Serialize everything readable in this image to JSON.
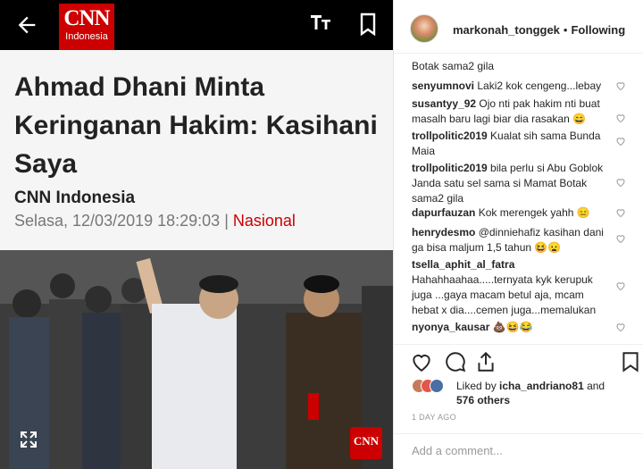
{
  "article": {
    "logo_main": "CNN",
    "logo_sub": "Indonesia",
    "text_size_icon_label": "ŦT",
    "headline": "Ahmad Dhani Minta Keringanan Hakim: Kasihani Saya",
    "source": "CNN Indonesia",
    "date": "Selasa, 12/03/2019 18:29:03",
    "separator": " | ",
    "category": "Nasional",
    "badge": "CNN",
    "accent_color": "#cc0000"
  },
  "post": {
    "username": "markonah_tonggek",
    "dot": "•",
    "follow_status": "Following",
    "comments": [
      {
        "user": "",
        "text": "Botak sama2 gila"
      },
      {
        "user": "senyumnovi",
        "text": "Laki2 kok cengeng...lebay"
      },
      {
        "user": "susantyy_92",
        "text": "Ojo nti pak hakim nti buat masalh baru lagi biar dia rasakan 😄"
      },
      {
        "user": "trollpolitic2019",
        "text": "Kualat sih sama Bunda Maia"
      },
      {
        "user": "trollpolitic2019",
        "text": "bila perlu si Abu Goblok Janda satu sel sama si Mamat Botak sama2 gila"
      },
      {
        "user": "dapurfauzan",
        "text": "Kok merengek yahh 😑"
      },
      {
        "user": "henrydesmo",
        "text": "@dinniehafiz kasihan dani ga bisa maljum 1,5 tahun 😆😦"
      },
      {
        "user": "tsella_aphit_al_fatra",
        "text": "Hahahhaahaa.....ternyata kyk kerupuk juga ...gaya macam betul aja, mcam hebat x dia....cemen juga...memalukan"
      },
      {
        "user": "nyonya_kausar",
        "text": "💩😆😂"
      }
    ],
    "liked_by_prefix": "Liked by ",
    "liked_by_user": "icha_andriano81",
    "liked_by_and": " and",
    "liked_by_count": "576 others",
    "time": "1 DAY AGO",
    "add_comment_placeholder": "Add a comment..."
  }
}
